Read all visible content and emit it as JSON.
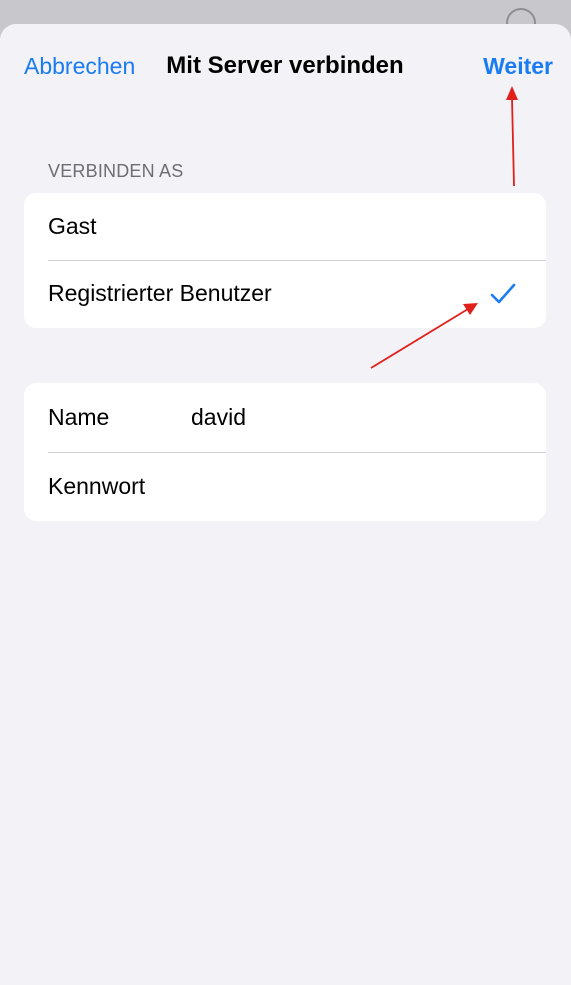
{
  "nav": {
    "cancel_label": "Abbrechen",
    "title": "Mit Server verbinden",
    "next_label": "Weiter"
  },
  "connect_as": {
    "header": "VERBINDEN AS",
    "options": [
      {
        "label": "Gast",
        "selected": false
      },
      {
        "label": "Registrierter Benutzer",
        "selected": true
      }
    ]
  },
  "credentials": {
    "name_label": "Name",
    "name_value": "david",
    "password_label": "Kennwort",
    "password_value": ""
  },
  "colors": {
    "accent": "#1a7cf2",
    "background": "#f2f2f7",
    "annotation": "#e0201b"
  },
  "icons": {
    "selected": "checkmark-icon"
  }
}
